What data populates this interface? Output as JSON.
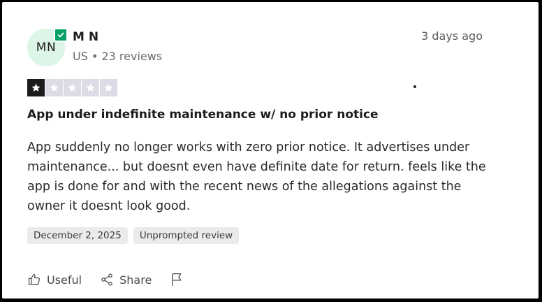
{
  "reviewer": {
    "initials": "MN",
    "name": "M N",
    "meta": "US • 23 reviews"
  },
  "posted_ago": "3 days ago",
  "rating": {
    "value": 1,
    "max": 5
  },
  "review": {
    "title": "App under indefinite maintenance w/ no prior notice",
    "body": "App suddenly no longer works with zero prior notice. It advertises under maintenance... but doesnt even have definite date for return. feels like the app is done for and with the recent news of the allegations against the owner it doesnt look good."
  },
  "tags": {
    "date": "December 2, 2025",
    "type": "Unprompted review"
  },
  "actions": {
    "useful_label": "Useful",
    "share_label": "Share"
  },
  "colors": {
    "avatar_bg": "#dcf5e7",
    "verified": "#04a065",
    "star_filled": "#1c1c1c",
    "star_empty": "#dcdce6"
  }
}
